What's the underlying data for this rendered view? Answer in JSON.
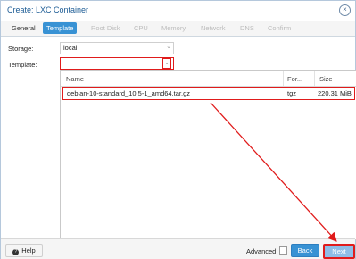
{
  "window": {
    "title": "Create: LXC Container"
  },
  "tabs": [
    {
      "label": "General",
      "state": "enabled"
    },
    {
      "label": "Template",
      "state": "active"
    },
    {
      "label": "Root Disk",
      "state": "disabled"
    },
    {
      "label": "CPU",
      "state": "disabled"
    },
    {
      "label": "Memory",
      "state": "disabled"
    },
    {
      "label": "Network",
      "state": "disabled"
    },
    {
      "label": "DNS",
      "state": "disabled"
    },
    {
      "label": "Confirm",
      "state": "disabled"
    }
  ],
  "form": {
    "storage_label": "Storage:",
    "storage_value": "local",
    "template_label": "Template:",
    "template_value": ""
  },
  "grid": {
    "columns": [
      "Name",
      "For...",
      "Size"
    ],
    "rows": [
      {
        "name": "debian-10-standard_10.5-1_amd64.tar.gz",
        "format": "tgz",
        "size": "220.31 MiB"
      }
    ]
  },
  "footer": {
    "help_label": "Help",
    "advanced_label": "Advanced",
    "back_label": "Back",
    "next_label": "Next"
  },
  "colors": {
    "accent": "#3892d4",
    "highlight": "#e01b1b",
    "title": "#1d5c95"
  }
}
